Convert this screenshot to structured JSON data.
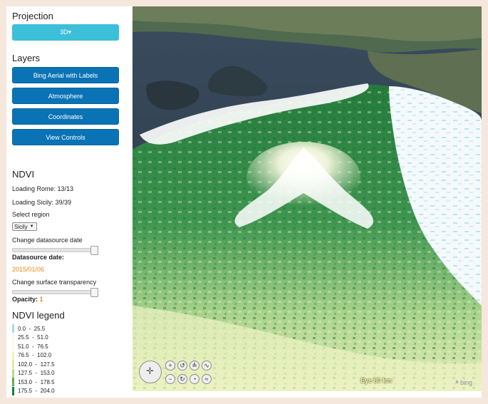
{
  "sidebar": {
    "projection": {
      "heading": "Projection",
      "button_label": "3D▾"
    },
    "layers": {
      "heading": "Layers",
      "items": [
        {
          "label": "Bing Aerial with Labels"
        },
        {
          "label": "Atmosphere"
        },
        {
          "label": "Coordinates"
        },
        {
          "label": "View Controls"
        }
      ]
    },
    "ndvi": {
      "heading": "NDVI",
      "loading_rome": "Loading Rome: 13/13",
      "loading_sicily": "Loading Sicily: 39/39",
      "select_region_label": "Select region",
      "region_value": "Sicily",
      "change_date_label": "Change datasource date",
      "date_slider_value": 1.0,
      "datasource_date_label": "Datasource date:",
      "datasource_date_value": "2015/01/06",
      "transparency_label": "Change surface transparency",
      "opacity_slider_value": 1.0,
      "opacity_label": "Opacity:",
      "opacity_value": "1"
    },
    "legend": {
      "heading": "NDVI legend",
      "rows": [
        {
          "range": "0.0  -  25.5",
          "color": "#a8d8ea"
        },
        {
          "range": "25.5  -  51.0",
          "color": "#f3fafc"
        },
        {
          "range": "51.0  -  76.5",
          "color": "#fbfbf0"
        },
        {
          "range": "76.5  -  102.0",
          "color": "#f4f3bf"
        },
        {
          "range": "102.0  -  127.5",
          "color": "#dcebb0"
        },
        {
          "range": "127.5  -  153.0",
          "color": "#b6d99b"
        },
        {
          "range": "153.0  -  178.5",
          "color": "#5fae63"
        },
        {
          "range": "175.5  -  204.0",
          "color": "#1f7a3d"
        }
      ]
    }
  },
  "globe": {
    "eye_readout": "Eye  80 km",
    "bing_logo": "bing",
    "controls": {
      "zoom_in": "+",
      "zoom_out": "−",
      "rotate_left": "↺",
      "rotate_right": "↻",
      "tilt_up": "≜",
      "tilt_down": "◔",
      "exaggerate_up": "∿",
      "exaggerate_down": "≈"
    }
  }
}
